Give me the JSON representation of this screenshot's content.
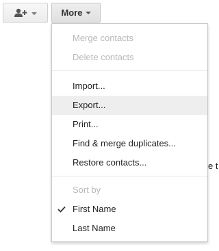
{
  "toolbar": {
    "add_contact_icon": "person-add-icon",
    "more_label": "More"
  },
  "menu": {
    "group1": [
      {
        "label": "Merge contacts",
        "enabled": false
      },
      {
        "label": "Delete contacts",
        "enabled": false
      }
    ],
    "group2": [
      {
        "label": "Import...",
        "enabled": true
      },
      {
        "label": "Export...",
        "enabled": true,
        "hovered": true
      },
      {
        "label": "Print...",
        "enabled": true
      },
      {
        "label": "Find & merge duplicates...",
        "enabled": true
      },
      {
        "label": "Restore contacts...",
        "enabled": true
      }
    ],
    "sort_header": "Sort by",
    "sort_options": [
      {
        "label": "First Name",
        "checked": true
      },
      {
        "label": "Last Name",
        "checked": false
      }
    ]
  },
  "background": {
    "clipped_text": "e t"
  }
}
